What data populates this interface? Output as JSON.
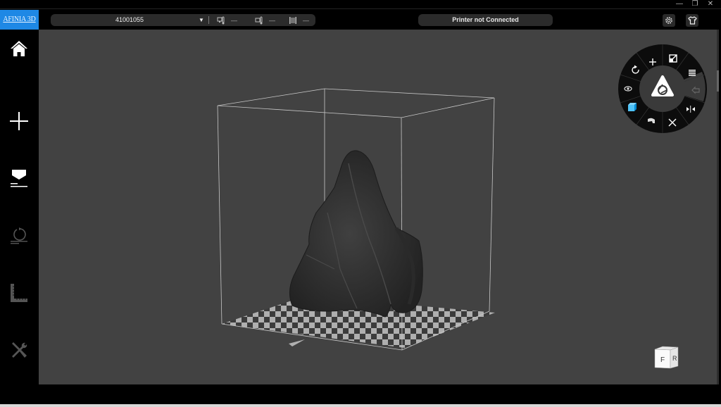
{
  "window": {
    "controls": [
      {
        "name": "minimize",
        "glyph": "—"
      },
      {
        "name": "restore",
        "glyph": "❐"
      },
      {
        "name": "close",
        "glyph": "✕"
      }
    ]
  },
  "header": {
    "brand": "AFINIA 3D",
    "printer_id": "41001055",
    "dropdown_glyph": "▼",
    "stats": [
      {
        "icon": "nozzle-temperature-icon",
        "value": "—"
      },
      {
        "icon": "bed-temperature-icon",
        "value": "—"
      },
      {
        "icon": "filament-spool-icon",
        "value": "—"
      }
    ],
    "status": "Printer not Connected",
    "right_icons": [
      "settings-gear-icon",
      "account-shirt-icon"
    ]
  },
  "sidebar": {
    "items": [
      {
        "name": "home",
        "icon": "home-icon",
        "active": true
      },
      {
        "name": "add",
        "icon": "plus-icon",
        "active": true
      },
      {
        "name": "print",
        "icon": "print-icon",
        "active": true
      },
      {
        "name": "initialize",
        "icon": "initialize-icon",
        "active": false
      },
      {
        "name": "calibrate",
        "icon": "ruler-calibrate-icon",
        "active": false
      },
      {
        "name": "maintenance",
        "icon": "tools-icon",
        "active": false
      }
    ]
  },
  "radial_menu": {
    "center": "afinia-logo-icon",
    "segments": [
      {
        "name": "move",
        "icon": "move-icon"
      },
      {
        "name": "scale",
        "icon": "scale-icon"
      },
      {
        "name": "layers",
        "icon": "layers-icon"
      },
      {
        "name": "undo",
        "icon": "undo-icon",
        "disabled": true
      },
      {
        "name": "mirror",
        "icon": "mirror-icon"
      },
      {
        "name": "fit",
        "icon": "fit-center-icon"
      },
      {
        "name": "place-on-bed",
        "icon": "place-on-bed-icon"
      },
      {
        "name": "view-solid",
        "icon": "cube-view-icon"
      },
      {
        "name": "view",
        "icon": "eye-icon"
      },
      {
        "name": "rotate",
        "icon": "rotate-icon"
      }
    ]
  },
  "view_cube": {
    "front": "F",
    "right": "R"
  },
  "colors": {
    "brand": "#1e88e5",
    "viewport_bg": "#424242",
    "pill_bg": "#2b2b2b",
    "cube_accent": "#4fc3f7"
  }
}
